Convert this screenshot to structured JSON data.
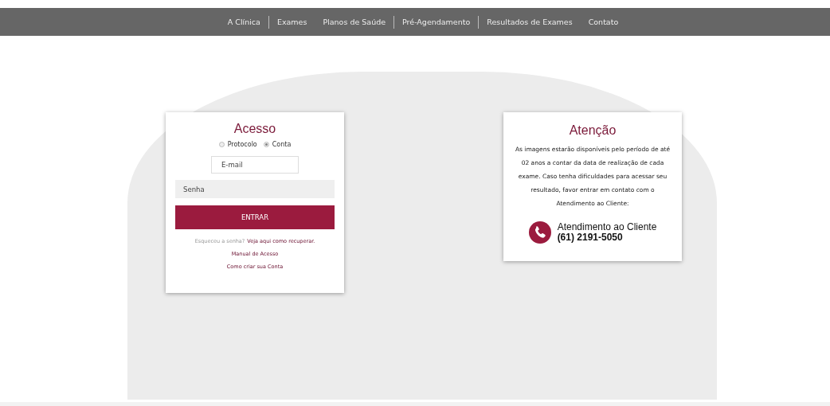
{
  "nav": [
    {
      "label": "A Clínica",
      "separator_after": true
    },
    {
      "label": "Exames",
      "separator_after": false
    },
    {
      "label": "Planos de Saúde",
      "separator_after": true
    },
    {
      "label": "Pré-Agendamento",
      "separator_after": true
    },
    {
      "label": "Resultados de Exames",
      "separator_after": false
    },
    {
      "label": "Contato",
      "separator_after": false
    }
  ],
  "login": {
    "title": "Acesso",
    "radios": [
      {
        "label": "Protocolo",
        "selected": false
      },
      {
        "label": "Conta",
        "selected": true
      }
    ],
    "email": {
      "placeholder": "E-mail"
    },
    "password": {
      "placeholder": "Senha"
    },
    "submit": "ENTRAR",
    "forgot_text": "Esqueceu a senha?",
    "forgot_link": "Veja aqui como recuperar.",
    "links": [
      "Manual de Acesso",
      "Como criar sua Conta"
    ]
  },
  "notice": {
    "title": "Atenção",
    "body": "As imagens estarão disponíveis pelo período de até 02 anos a contar da data de realização de cada exame. Caso tenha dificuldades para acessar seu resultado, favor entrar em contato com o Atendimento ao Cliente:",
    "contact_label": "Atendimento ao Cliente",
    "contact_phone": "(61) 2191-5050"
  }
}
